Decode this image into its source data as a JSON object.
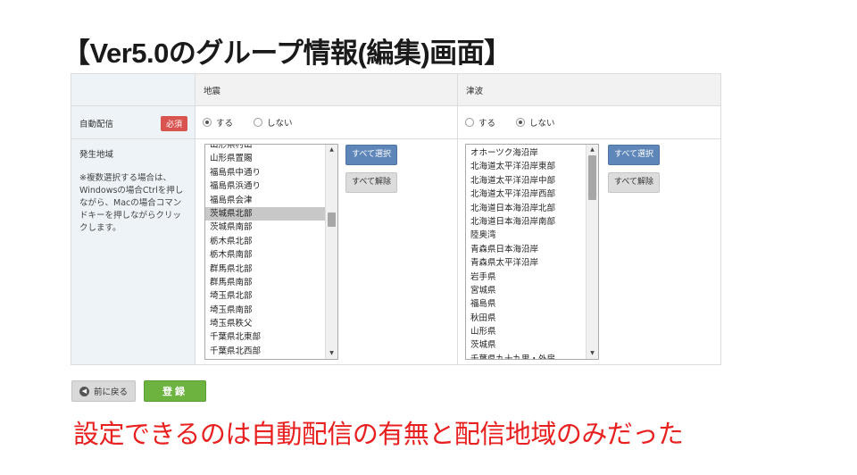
{
  "title": "【Ver5.0のグループ情報(編集)画面】",
  "columns": {
    "area": "地震",
    "tsunami": "津波"
  },
  "auto_delivery": {
    "label": "自動配信",
    "required": "必須",
    "option_on": "する",
    "option_off": "しない",
    "area_selected": "on",
    "tsunami_selected": "off"
  },
  "region": {
    "label": "発生地域",
    "note": "※複数選択する場合は、Windowsの場合Ctrlを押しながら、Macの場合コマンドキーを押しながらクリックします。"
  },
  "area_list": {
    "items": [
      "山形県村山",
      "山形県置賜",
      "福島県中通り",
      "福島県浜通り",
      "福島県会津",
      "茨城県北部",
      "茨城県南部",
      "栃木県北部",
      "栃木県南部",
      "群馬県北部",
      "群馬県南部",
      "埼玉県北部",
      "埼玉県南部",
      "埼玉県秩父",
      "千葉県北東部",
      "千葉県北西部"
    ],
    "selected": "茨城県北部"
  },
  "tsunami_list": {
    "items": [
      "オホーツク海沿岸",
      "北海道太平洋沿岸東部",
      "北海道太平洋沿岸中部",
      "北海道太平洋沿岸西部",
      "北海道日本海沿岸北部",
      "北海道日本海沿岸南部",
      "陸奥湾",
      "青森県日本海沿岸",
      "青森県太平洋沿岸",
      "岩手県",
      "宮城県",
      "福島県",
      "秋田県",
      "山形県",
      "茨城県",
      "千葉県九十九里・外房"
    ]
  },
  "buttons": {
    "select_all": "すべて選択",
    "clear_all": "すべて解除",
    "back": "前に戻る",
    "submit": "登録"
  },
  "caption": "設定できるのは自動配信の有無と配信地域のみだった",
  "colors": {
    "accent_blue": "#5f86b8",
    "submit_green": "#6cb33f",
    "required_red": "#d9534f",
    "caption_red": "#e8201f"
  }
}
